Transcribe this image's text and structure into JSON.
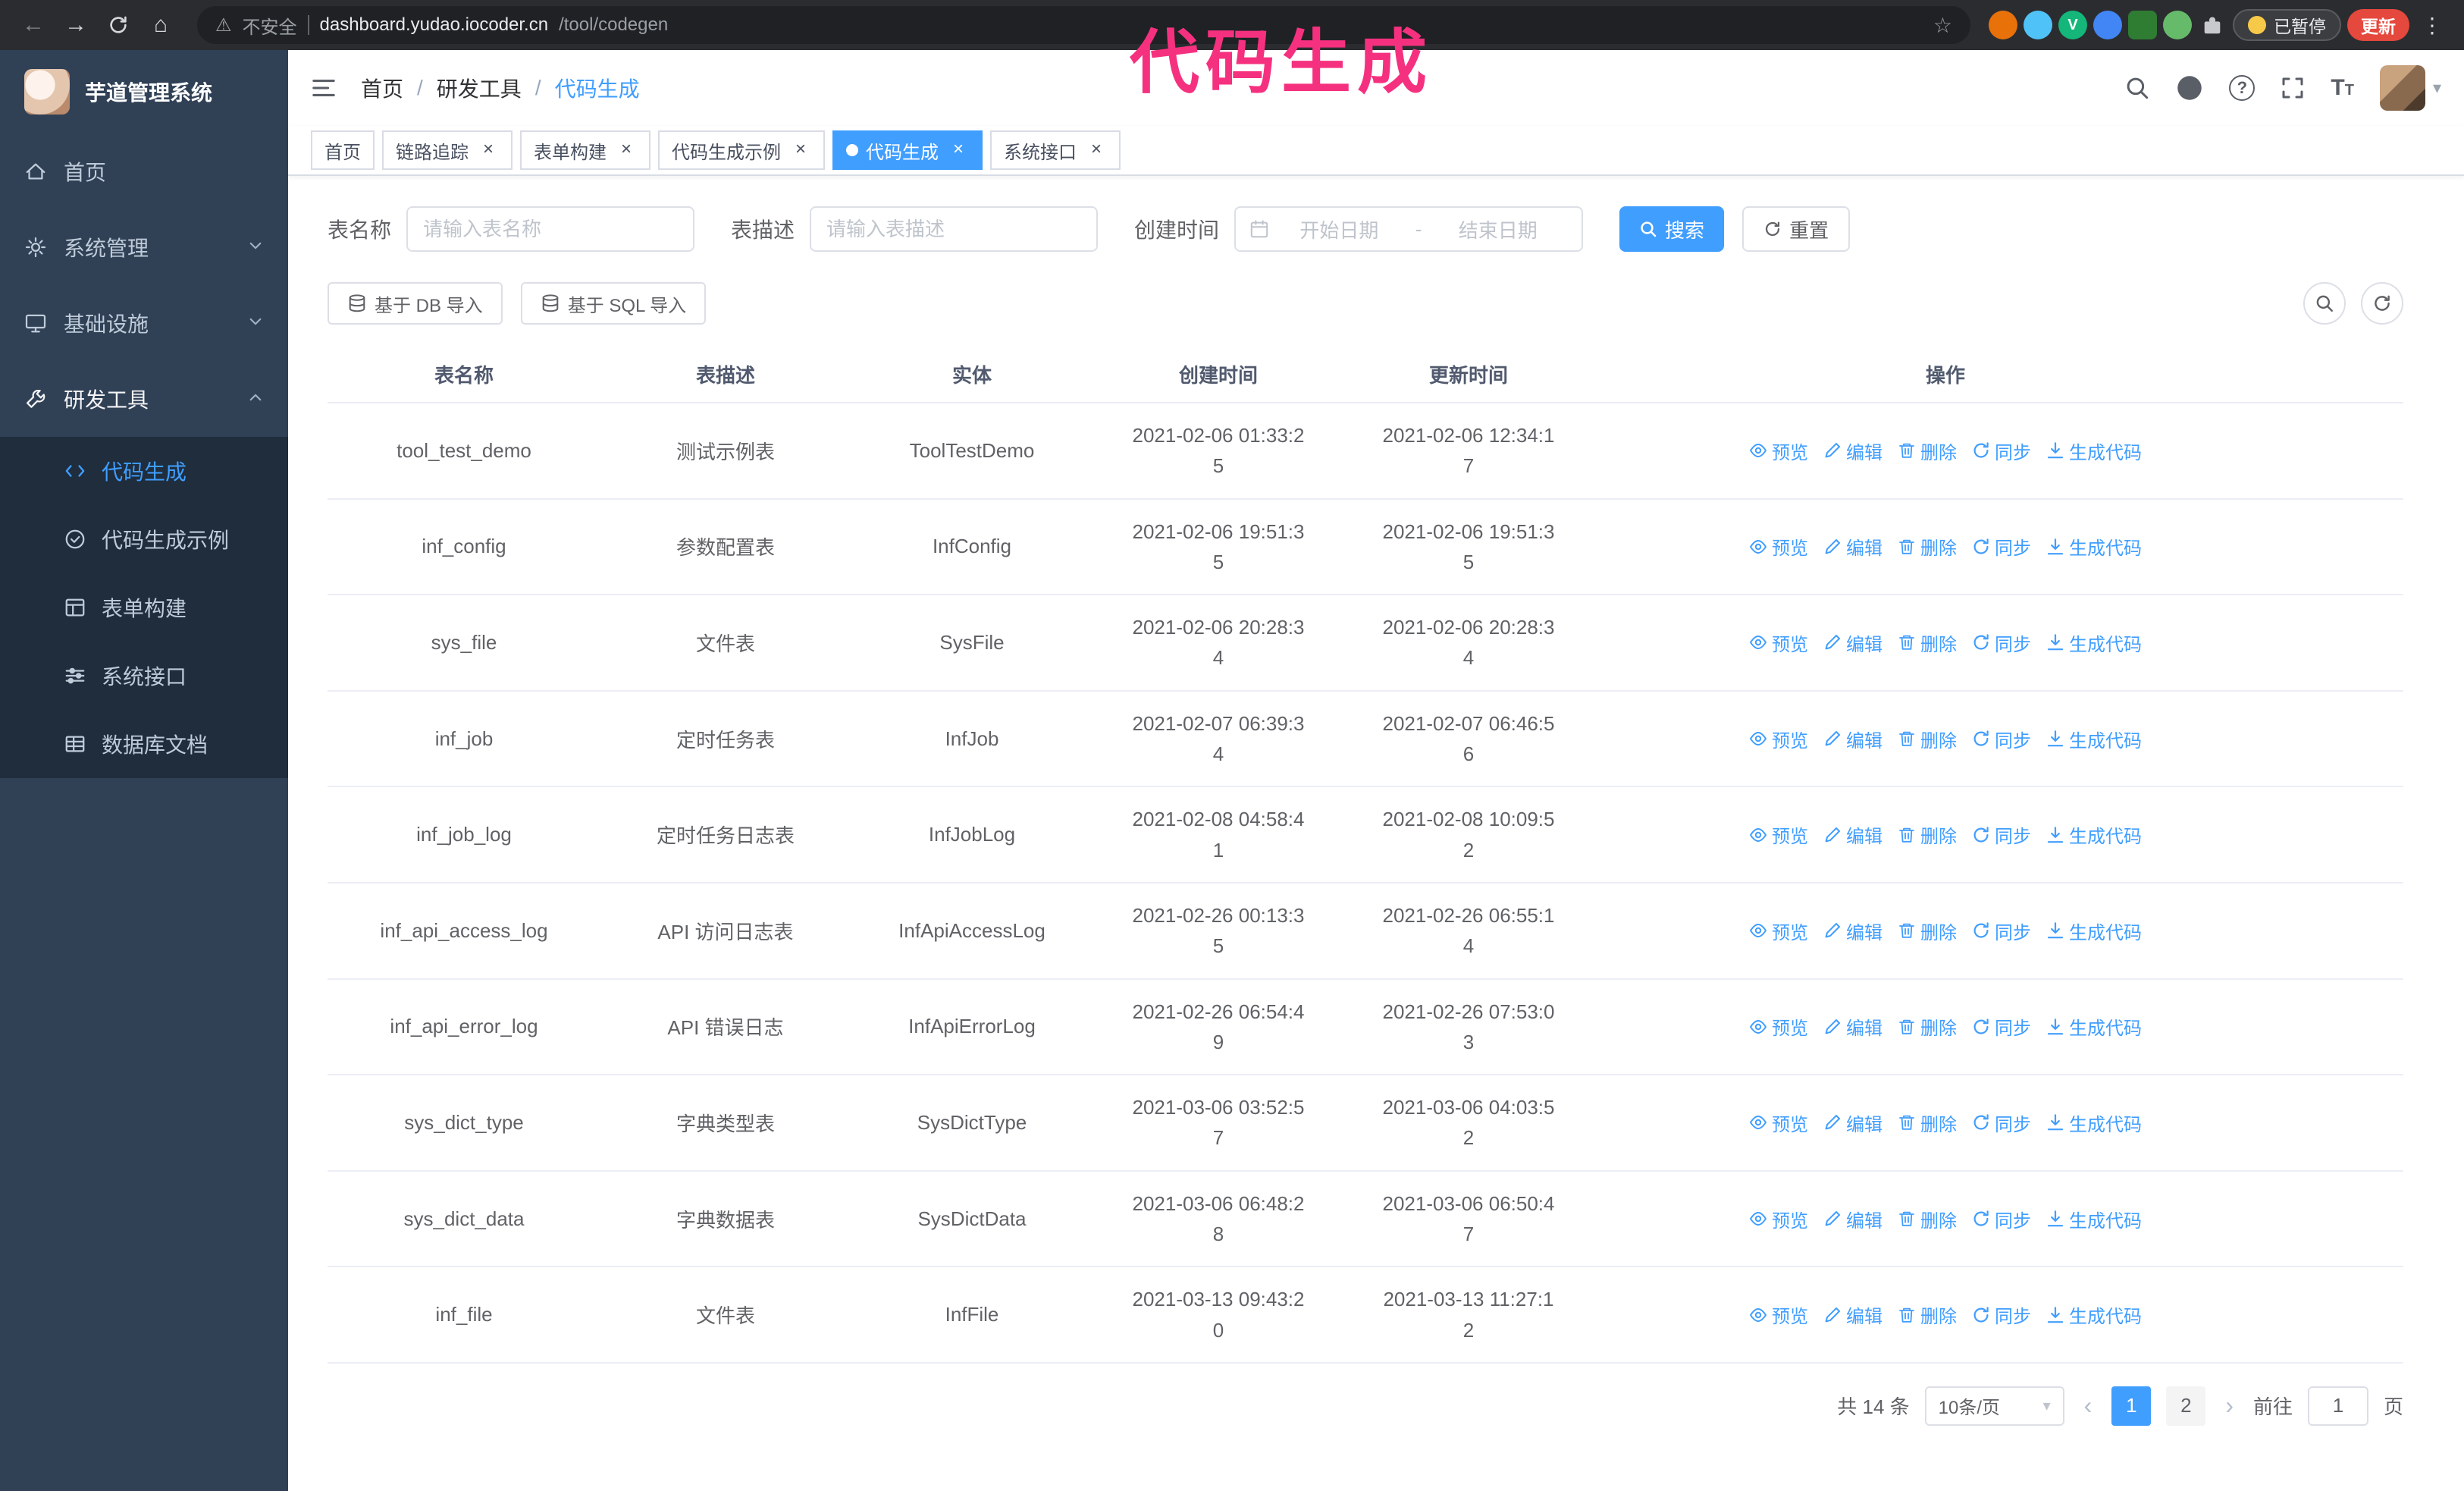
{
  "colors": {
    "accent": "#409EFF",
    "sidebar_bg": "#304156",
    "submenu_bg": "#1f2d3d",
    "annotation_pink": "#f5317f",
    "update_red": "#e5483d"
  },
  "glyphs": {
    "back": "←",
    "forward": "→",
    "home": "⌂",
    "warning": "⚠",
    "star": "☆",
    "kebab": "⋮",
    "close": "×",
    "caret_down": "▾",
    "question": "?",
    "prev": "‹",
    "next": "›",
    "breadcrumb_sep": "/",
    "t_large": "T",
    "t_small": "T"
  },
  "annotation_text": "代码生成",
  "browser": {
    "security_label": "不安全",
    "url_host": "dashboard.yudao.iocoder.cn",
    "url_path": "/tool/codegen",
    "paused_badge": "已暂停",
    "update_button": "更新"
  },
  "sidebar": {
    "logo_title": "芋道管理系统",
    "items": [
      {
        "label": "首页"
      },
      {
        "label": "系统管理"
      },
      {
        "label": "基础设施"
      },
      {
        "label": "研发工具"
      }
    ],
    "subitems": [
      {
        "label": "代码生成"
      },
      {
        "label": "代码生成示例"
      },
      {
        "label": "表单构建"
      },
      {
        "label": "系统接口"
      },
      {
        "label": "数据库文档"
      }
    ]
  },
  "header": {
    "breadcrumb": [
      "首页",
      "研发工具",
      "代码生成"
    ]
  },
  "tabs": [
    {
      "label": "首页"
    },
    {
      "label": "链路追踪"
    },
    {
      "label": "表单构建"
    },
    {
      "label": "代码生成示例"
    },
    {
      "label": "代码生成"
    },
    {
      "label": "系统接口"
    }
  ],
  "filters": {
    "table_name_label": "表名称",
    "table_name_placeholder": "请输入表名称",
    "table_desc_label": "表描述",
    "table_desc_placeholder": "请输入表描述",
    "create_time_label": "创建时间",
    "date_start_placeholder": "开始日期",
    "date_separator": "-",
    "date_end_placeholder": "结束日期",
    "search_button": "搜索",
    "reset_button": "重置"
  },
  "toolbar": {
    "import_db": "基于 DB 导入",
    "import_sql": "基于 SQL 导入"
  },
  "table": {
    "columns": [
      "表名称",
      "表描述",
      "实体",
      "创建时间",
      "更新时间",
      "操作"
    ],
    "actions": [
      "预览",
      "编辑",
      "删除",
      "同步",
      "生成代码"
    ],
    "rows": [
      {
        "name": "tool_test_demo",
        "desc": "测试示例表",
        "entity": "ToolTestDemo",
        "created": "2021-02-06 01:33:25",
        "updated": "2021-02-06 12:34:17"
      },
      {
        "name": "inf_config",
        "desc": "参数配置表",
        "entity": "InfConfig",
        "created": "2021-02-06 19:51:35",
        "updated": "2021-02-06 19:51:35"
      },
      {
        "name": "sys_file",
        "desc": "文件表",
        "entity": "SysFile",
        "created": "2021-02-06 20:28:34",
        "updated": "2021-02-06 20:28:34"
      },
      {
        "name": "inf_job",
        "desc": "定时任务表",
        "entity": "InfJob",
        "created": "2021-02-07 06:39:34",
        "updated": "2021-02-07 06:46:56"
      },
      {
        "name": "inf_job_log",
        "desc": "定时任务日志表",
        "entity": "InfJobLog",
        "created": "2021-02-08 04:58:41",
        "updated": "2021-02-08 10:09:52"
      },
      {
        "name": "inf_api_access_log",
        "desc": "API 访问日志表",
        "entity": "InfApiAccessLog",
        "created": "2021-02-26 00:13:35",
        "updated": "2021-02-26 06:55:14"
      },
      {
        "name": "inf_api_error_log",
        "desc": "API 错误日志",
        "entity": "InfApiErrorLog",
        "created": "2021-02-26 06:54:49",
        "updated": "2021-02-26 07:53:03"
      },
      {
        "name": "sys_dict_type",
        "desc": "字典类型表",
        "entity": "SysDictType",
        "created": "2021-03-06 03:52:57",
        "updated": "2021-03-06 04:03:52"
      },
      {
        "name": "sys_dict_data",
        "desc": "字典数据表",
        "entity": "SysDictData",
        "created": "2021-03-06 06:48:28",
        "updated": "2021-03-06 06:50:47"
      },
      {
        "name": "inf_file",
        "desc": "文件表",
        "entity": "InfFile",
        "created": "2021-03-13 09:43:20",
        "updated": "2021-03-13 11:27:12"
      }
    ]
  },
  "pagination": {
    "total": "共 14 条",
    "page_size": "10条/页",
    "pages": [
      "1",
      "2"
    ],
    "goto_label": "前往",
    "goto_value": "1",
    "page_unit": "页"
  }
}
